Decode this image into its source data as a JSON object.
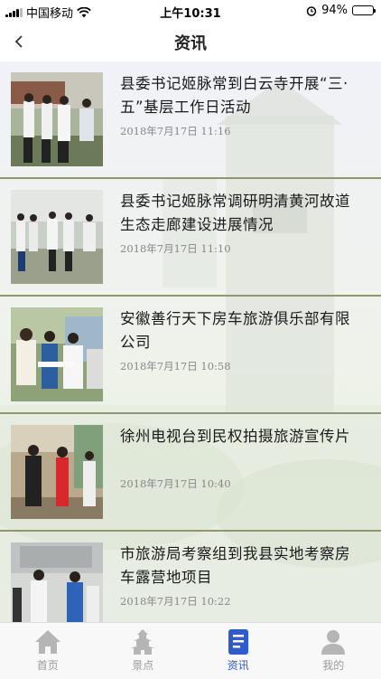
{
  "status_bar": {
    "carrier": "中国移动",
    "time": "上午10:31",
    "battery": "94%",
    "battery_level": 0.94
  },
  "navbar": {
    "title": "资讯",
    "back_icon": "chevron-left-icon"
  },
  "articles": [
    {
      "title": "县委书记姬脉常到白云寺开展“三·五”基层工作日活动",
      "time": "2018年7月17日 11:16"
    },
    {
      "title": "县委书记姬脉常调研明清黄河故道生态走廊建设进展情况",
      "time": "2018年7月17日 11:10"
    },
    {
      "title": "安徽善行天下房车旅游俱乐部有限公司",
      "time": "2018年7月17日 10:58"
    },
    {
      "title": "徐州电视台到民权拍摄旅游宣传片",
      "time": "2018年7月17日 10:40"
    },
    {
      "title": "市旅游局考察组到我县实地考察房车露营地项目",
      "time": "2018年7月17日 10:22"
    }
  ],
  "tabbar": {
    "active_color": "#2f5ccd",
    "inactive_color": "#9a9a9a",
    "items": [
      {
        "label": "首页",
        "icon": "home-icon"
      },
      {
        "label": "景点",
        "icon": "pagoda-icon"
      },
      {
        "label": "资讯",
        "icon": "document-icon"
      },
      {
        "label": "我的",
        "icon": "person-icon"
      }
    ]
  }
}
